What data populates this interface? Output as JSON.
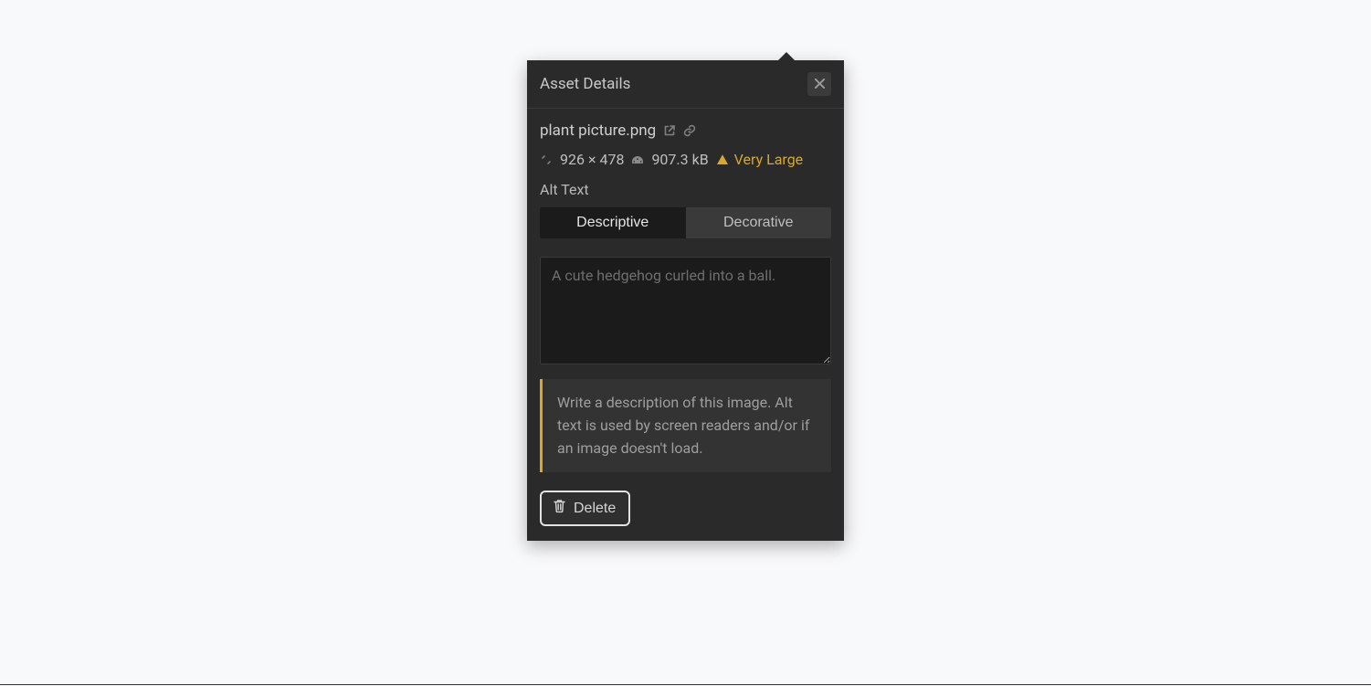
{
  "panel": {
    "title": "Asset Details"
  },
  "file": {
    "name": "plant picture.png",
    "dimensions": "926 × 478",
    "size": "907.3 kB",
    "warning_label": "Very Large"
  },
  "alt": {
    "section_label": "Alt Text",
    "tab_descriptive": "Descriptive",
    "tab_decorative": "Decorative",
    "textarea_value": "",
    "textarea_placeholder": "A cute hedgehog curled into a ball.",
    "note": "Write a description of this image. Alt text is used by screen readers and/or if an image doesn't load."
  },
  "actions": {
    "delete_label": "Delete"
  }
}
